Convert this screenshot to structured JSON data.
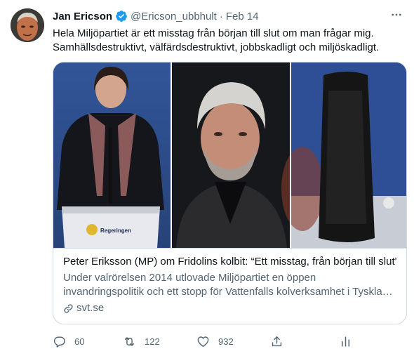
{
  "tweet": {
    "author_name": "Jan Ericson",
    "handle": "@Ericson_ubbhult",
    "separator": "·",
    "date": "Feb 14",
    "text_lines": [
      "Hela Miljöpartiet är ett misstag från början till slut om man frågar mig.",
      "Samhällsdestruktivt, välfärdsdestruktivt, jobbskadligt  och miljöskadligt."
    ]
  },
  "card": {
    "podium_label": "Regeringen",
    "title": "Peter Eriksson (MP) om Fridolins kolbit: “Ett misstag, från början till slut”",
    "description_lines": [
      "Under valrörelsen 2014 utlovade Miljöpartiet en öppen",
      "invandringspolitik och ett stopp för Vattenfalls kolverksamhet i Tysklan..."
    ],
    "domain": "svt.se"
  },
  "actions": {
    "reply_count": "60",
    "retweet_count": "122",
    "like_count": "932"
  },
  "colors": {
    "verified": "#1d9bf0",
    "secondary_text": "#536471",
    "border": "#cfd9de"
  }
}
